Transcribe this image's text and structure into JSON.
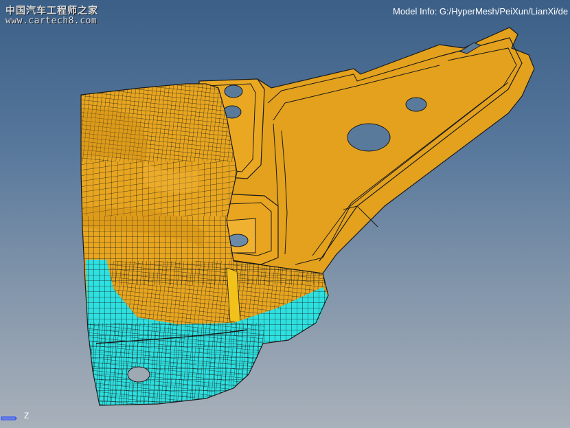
{
  "viewport": {
    "watermark_line1": "中国汽车工程师之家",
    "watermark_line2": "www.cartech8.com",
    "model_info": "Model Info: G:/HyperMesh/PeiXun/LianXi/de",
    "triad_axis": "Z"
  },
  "colors": {
    "background_top": "#3b5f87",
    "background_bottom": "#a9b1ba",
    "part_orange": "#e3a11d",
    "part_orange_dark": "#c98811",
    "part_cyan": "#2ee0e0",
    "mesh_line": "#1a1a1a",
    "text_white": "#ffffff"
  },
  "model": {
    "parts": [
      "orange-bracket-part",
      "cyan-base-part"
    ],
    "element_type": "shell-quad-mesh"
  }
}
